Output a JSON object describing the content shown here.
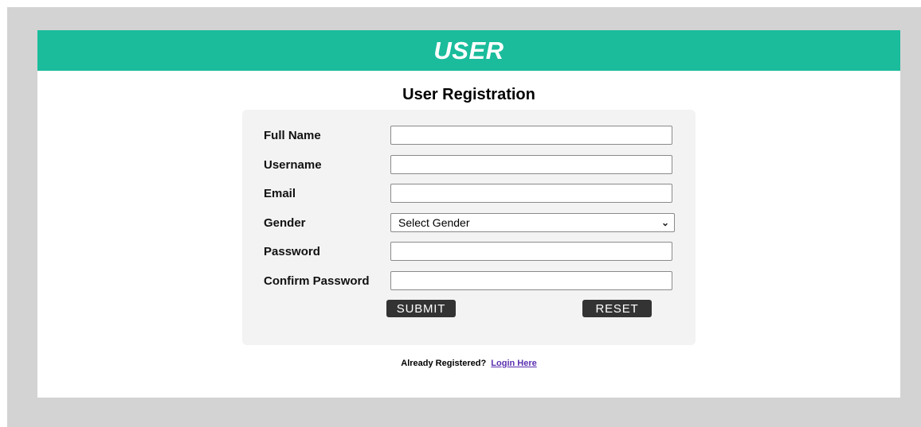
{
  "header": {
    "title": "USER"
  },
  "form": {
    "title": "User Registration",
    "fields": {
      "full_name": {
        "label": "Full Name",
        "value": ""
      },
      "username": {
        "label": "Username",
        "value": ""
      },
      "email": {
        "label": "Email",
        "value": ""
      },
      "gender": {
        "label": "Gender",
        "selected": "Select Gender"
      },
      "password": {
        "label": "Password",
        "value": ""
      },
      "confirm_password": {
        "label": "Confirm Password",
        "value": ""
      }
    },
    "submit_label": "SUBMIT",
    "reset_label": "RESET"
  },
  "footer": {
    "text": "Already Registered?",
    "link_label": "Login Here"
  },
  "colors": {
    "header_bg": "#1abc9c",
    "panel_bg": "#f3f3f3",
    "backdrop": "#d3d3d3",
    "button_bg": "#333333",
    "link": "#5b2fb0"
  },
  "icons": {
    "select_arrow": "chevron-down-icon"
  }
}
